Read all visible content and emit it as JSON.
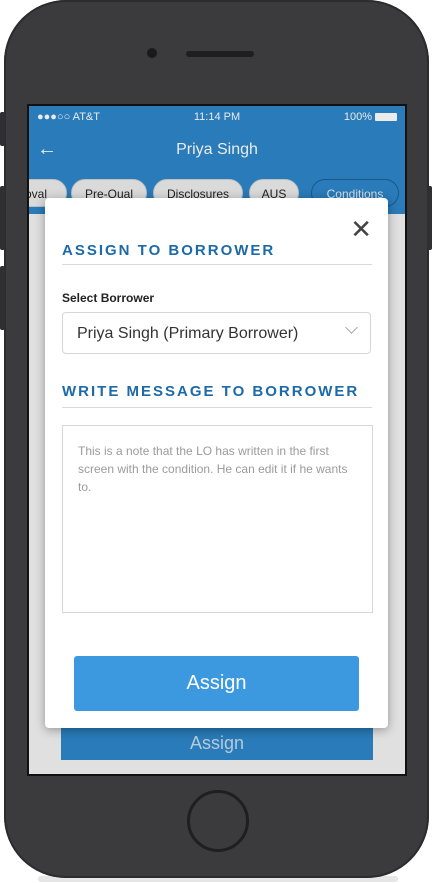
{
  "status_bar": {
    "carrier": "●●●○○ AT&T",
    "time": "11:14 PM",
    "battery": "100%"
  },
  "nav": {
    "title": "Priya Singh"
  },
  "tabs": [
    "oval",
    "Pre-Qual",
    "Disclosures",
    "AUS",
    "Conditions"
  ],
  "background_button": "Assign",
  "modal": {
    "assign_title": "ASSIGN TO BORROWER",
    "select_label": "Select Borrower",
    "selected_borrower": "Priya Singh (Primary Borrower)",
    "message_title": "WRITE MESSAGE TO BORROWER",
    "message_text": "This is a note that the LO has written in the first screen with the condition. He can edit it if he wants to.",
    "assign_label": "Assign",
    "close_label": "✕"
  },
  "colors": {
    "primary": "#2d86c9",
    "title_blue": "#1d6aa8",
    "button": "#3d99df"
  }
}
